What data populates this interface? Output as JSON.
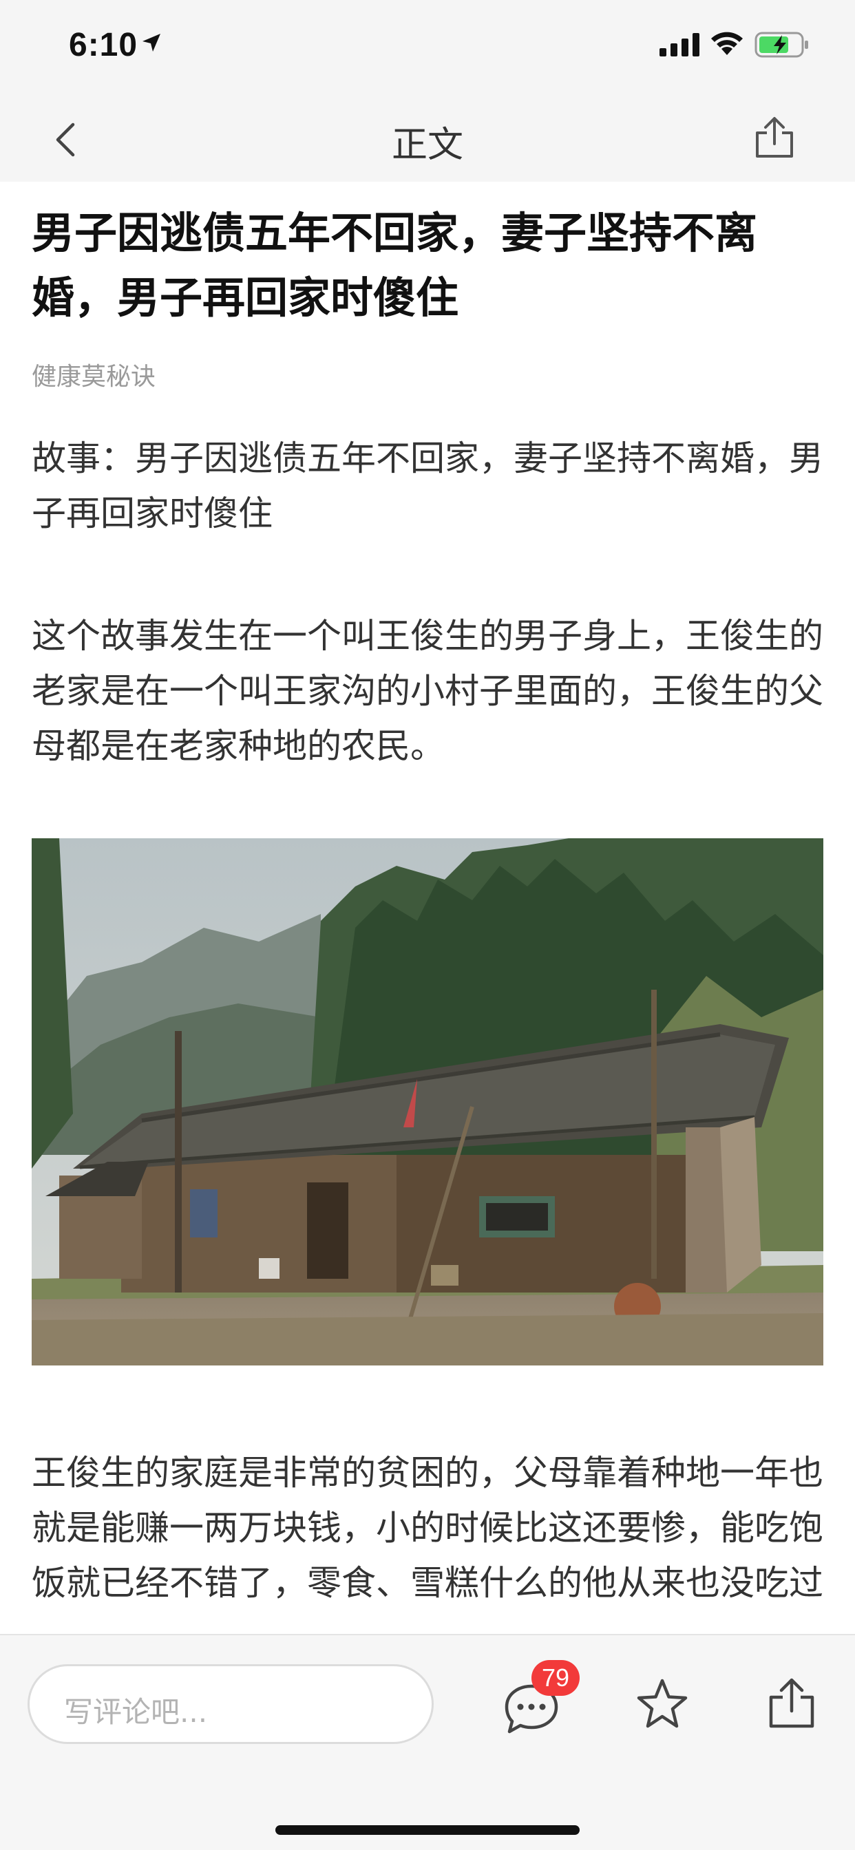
{
  "status_bar": {
    "time": "6:10",
    "icons": [
      "location-arrow-icon",
      "signal-icon",
      "wifi-icon",
      "battery-charging-icon"
    ],
    "battery_color": "#4cd964"
  },
  "nav": {
    "title": "正文",
    "back_icon": "chevron-left-icon",
    "share_icon": "share-icon"
  },
  "article": {
    "title": "男子因逃债五年不回家，妻子坚持不离婚，男子再回家时傻住",
    "source": "健康莫秘诀",
    "paragraphs": [
      "故事：男子因逃债五年不回家，妻子坚持不离婚，男子再回家时傻住",
      "这个故事发生在一个叫王俊生的男子身上，王俊生的老家是在一个叫王家沟的小村子里面的，王俊生的父母都是在老家种地的农民。",
      "王俊生的家庭是非常的贫困的，父母靠着种地一年也就是能赚一两万块钱，小的时候比这还要惨，能吃饱饭就已经不错了，零食、雪糕什么的他从来也没吃过"
    ]
  },
  "bottom_bar": {
    "comment_placeholder": "写评论吧...",
    "comment_count": "79",
    "badge_color": "#f23a3a"
  }
}
